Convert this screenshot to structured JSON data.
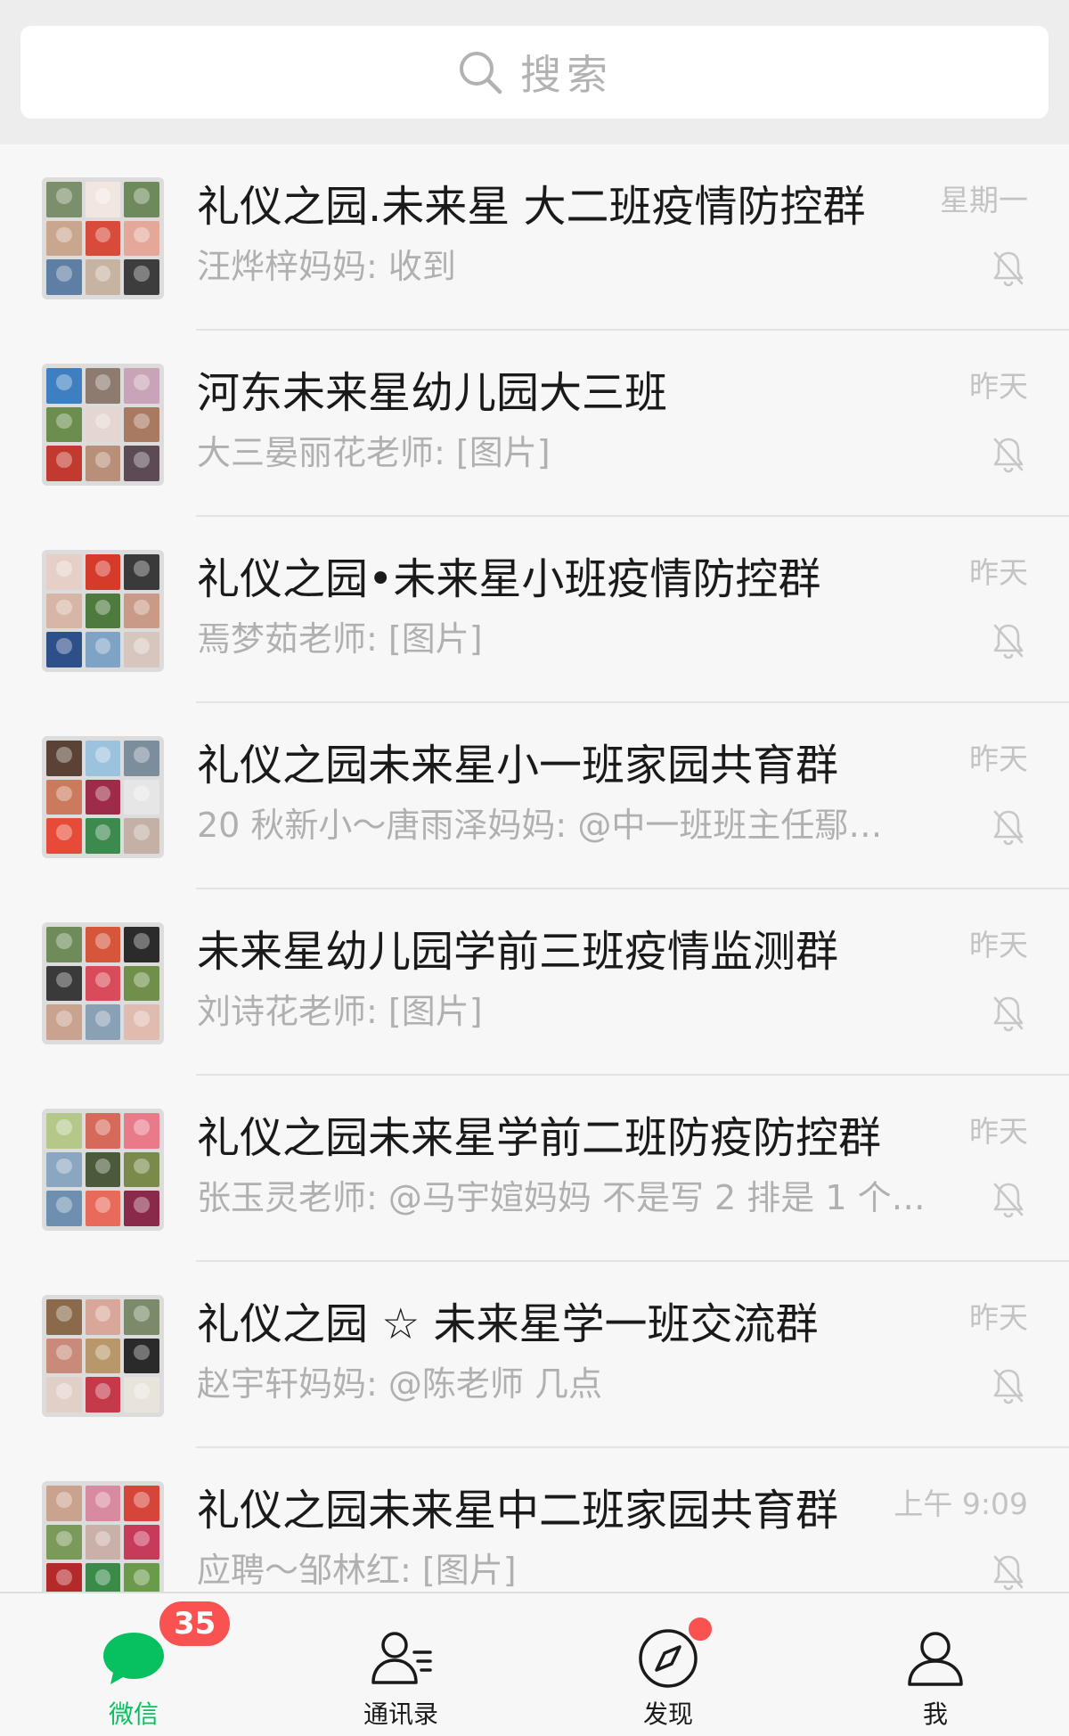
{
  "search": {
    "placeholder": "搜索"
  },
  "chats": [
    {
      "title": "礼仪之园.未来星 大二班疫情防控群",
      "preview": "汪烨梓妈妈: 收到",
      "time": "星期一",
      "muted": true,
      "avatar_colors": [
        "#7a8f6a",
        "#f1e6e0",
        "#6e8a5c",
        "#c9a68e",
        "#d84b3a",
        "#e3a89a",
        "#5e7fa3",
        "#c7b3a2",
        "#3d3d3d"
      ]
    },
    {
      "title": "河东未来星幼儿园大三班",
      "preview": "大三晏丽花老师: [图片]",
      "time": "昨天",
      "muted": true,
      "avatar_colors": [
        "#3e7fc2",
        "#8c7b6e",
        "#c9a3b7",
        "#6b8e4e",
        "#e4d6d0",
        "#a97a62",
        "#c23a2f",
        "#b8907a",
        "#5c4a55"
      ]
    },
    {
      "title": "礼仪之园•未来星小班疫情防控群",
      "preview": "焉梦茹老师: [图片]",
      "time": "昨天",
      "muted": true,
      "avatar_colors": [
        "#e6cfc6",
        "#d63a2a",
        "#3a3a3a",
        "#d8b6a6",
        "#4e7a3e",
        "#c99a88",
        "#2d4f8a",
        "#7fa3c4",
        "#d7c6be"
      ]
    },
    {
      "title": "礼仪之园未来星小一班家园共育群",
      "preview": "20 秋新小～唐雨泽妈妈: @中一班班主任鄢…",
      "time": "昨天",
      "muted": true,
      "avatar_colors": [
        "#5a4236",
        "#9cc3dd",
        "#7c8d9c",
        "#cc7a5e",
        "#9e2b47",
        "#e6e6e6",
        "#e84a3a",
        "#3c8a4e",
        "#c4b0a4"
      ]
    },
    {
      "title": "未来星幼儿园学前三班疫情监测群",
      "preview": "刘诗花老师: [图片]",
      "time": "昨天",
      "muted": true,
      "avatar_colors": [
        "#6e8c5a",
        "#d5563b",
        "#2b2b2b",
        "#3a3a3a",
        "#d94a5a",
        "#6f8f4a",
        "#c9a290",
        "#8aa0b4",
        "#e0bcb0"
      ]
    },
    {
      "title": "礼仪之园未来星学前二班防疫防控群",
      "preview": "张玉灵老师: @马宇媗妈妈 不是写 2 排是 1 个…",
      "time": "昨天",
      "muted": true,
      "avatar_colors": [
        "#b4c88a",
        "#d66a5a",
        "#e87a8a",
        "#8aa6c0",
        "#4a5a3a",
        "#7a8a4a",
        "#6e8fb0",
        "#e86a5a",
        "#8a2a4a"
      ]
    },
    {
      "title": "礼仪之园 ☆ 未来星学一班交流群",
      "preview": "赵宇轩妈妈: @陈老师 几点",
      "time": "昨天",
      "muted": true,
      "avatar_colors": [
        "#8a6a4a",
        "#d9a69a",
        "#7a8a6a",
        "#c98a7a",
        "#b8986a",
        "#2a2a2a",
        "#e0d0c8",
        "#c43a4a",
        "#e8e4dc"
      ]
    },
    {
      "title": "礼仪之园未来星中二班家园共育群",
      "preview": "应聘～邹林红: [图片]",
      "time": "上午 9:09",
      "muted": true,
      "avatar_colors": [
        "#c9a38e",
        "#d88aa0",
        "#d6453a",
        "#7a9a5a",
        "#c9b0a8",
        "#c83a5a",
        "#b42a2a",
        "#3a8a4a",
        "#6a9a4a"
      ]
    }
  ],
  "tabbar": {
    "tabs": [
      {
        "label": "微信",
        "active": true,
        "badge": "35",
        "icon": "chat-bubble-icon"
      },
      {
        "label": "通讯录",
        "active": false,
        "icon": "contacts-icon"
      },
      {
        "label": "发现",
        "active": false,
        "dot": true,
        "icon": "compass-icon"
      },
      {
        "label": "我",
        "active": false,
        "icon": "person-icon"
      }
    ]
  },
  "colors": {
    "accent": "#07c160",
    "badge": "#fa5151",
    "title_text": "#1a1a1a",
    "secondary_text": "#b0b0b0"
  }
}
